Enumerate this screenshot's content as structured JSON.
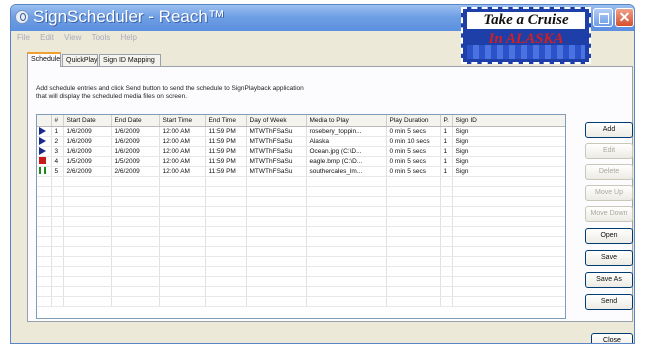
{
  "window": {
    "title": "SignScheduler - Reach™"
  },
  "promo": {
    "line1": "Take a Cruise",
    "line2": "In ALASKA"
  },
  "menu": [
    "File",
    "Edit",
    "View",
    "Tools",
    "Help"
  ],
  "tabs": [
    {
      "label": "Schedule",
      "active": true
    },
    {
      "label": "QuickPlay",
      "active": false
    },
    {
      "label": "Sign ID Mapping",
      "active": false
    }
  ],
  "instructions": {
    "line1": "Add schedule entries and click Send button to send the schedule to SignPlayback application",
    "line2": "that will display the scheduled media files on screen."
  },
  "table": {
    "columns": [
      "",
      "#",
      "Start Date",
      "End Date",
      "Start Time",
      "End Time",
      "Day of Week",
      "Media to Play",
      "Play Duration",
      "P.",
      "Sign ID"
    ],
    "rows": [
      {
        "status": "play",
        "num": "1",
        "start_date": "1/6/2009",
        "end_date": "1/6/2009",
        "start_time": "12:00 AM",
        "end_time": "11:59 PM",
        "dow": "MTWThFSaSu",
        "media": "rosebery_toppin...",
        "duration": "0 min 5 secs",
        "p": "1",
        "sign": "Sign"
      },
      {
        "status": "play",
        "num": "2",
        "start_date": "1/6/2009",
        "end_date": "1/6/2009",
        "start_time": "12:00 AM",
        "end_time": "11:59 PM",
        "dow": "MTWThFSaSu",
        "media": "Alaska",
        "duration": "0 min 10 secs",
        "p": "1",
        "sign": "Sign"
      },
      {
        "status": "play",
        "num": "3",
        "start_date": "1/6/2009",
        "end_date": "1/6/2009",
        "start_time": "12:00 AM",
        "end_time": "11:59 PM",
        "dow": "MTWThFSaSu",
        "media": "Ocean.jpg (C:\\D...",
        "duration": "0 min 5 secs",
        "p": "1",
        "sign": "Sign"
      },
      {
        "status": "stop",
        "num": "4",
        "start_date": "1/5/2009",
        "end_date": "1/5/2009",
        "start_time": "12:00 AM",
        "end_time": "11:59 PM",
        "dow": "MTWThFSaSu",
        "media": "eagle.bmp (C:\\D...",
        "duration": "0 min 5 secs",
        "p": "1",
        "sign": "Sign"
      },
      {
        "status": "pause",
        "num": "5",
        "start_date": "2/6/2009",
        "end_date": "2/6/2009",
        "start_time": "12:00 AM",
        "end_time": "11:59 PM",
        "dow": "MTWThFSaSu",
        "media": "southercales_lm...",
        "duration": "0 min 5 secs",
        "p": "1",
        "sign": "Sign"
      }
    ],
    "empty_rows": 13
  },
  "buttons": {
    "add": "Add",
    "edit": "Edit",
    "delete": "Delete",
    "move_up": "Move Up",
    "move_down": "Move Down",
    "open": "Open",
    "save": "Save",
    "save_as": "Save As",
    "send": "Send",
    "close": "Close"
  },
  "colors": {
    "titlebar": "#6f9fe4",
    "play": "#1a2a8a",
    "stop": "#c81818",
    "pause": "#1a8a1a"
  }
}
